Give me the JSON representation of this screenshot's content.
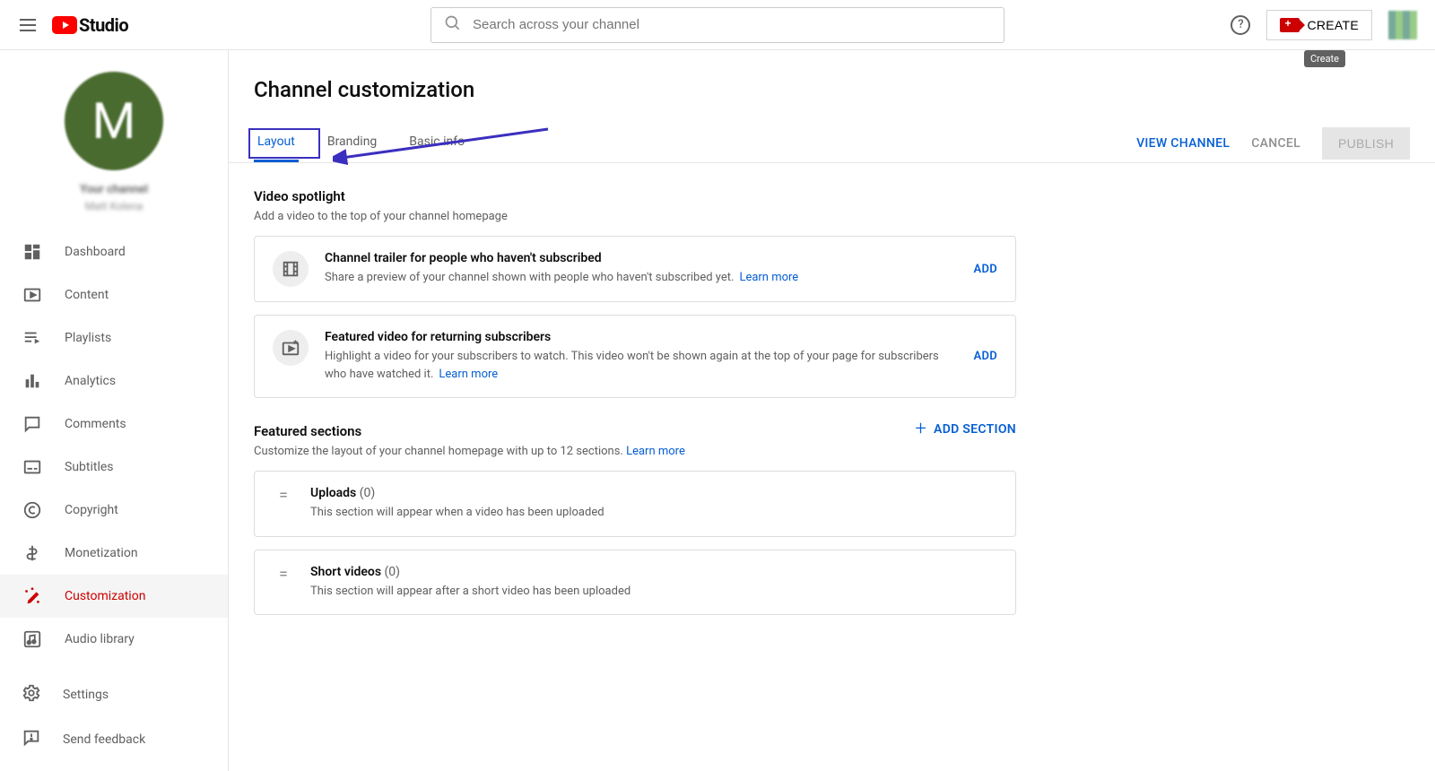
{
  "header": {
    "logo_text": "Studio",
    "search_placeholder": "Search across your channel",
    "create_label": "CREATE",
    "tooltip": "Create"
  },
  "sidebar": {
    "channel_label": "Your channel",
    "channel_name": "Matt Kolena",
    "avatar_letter": "M",
    "items": [
      {
        "label": "Dashboard"
      },
      {
        "label": "Content"
      },
      {
        "label": "Playlists"
      },
      {
        "label": "Analytics"
      },
      {
        "label": "Comments"
      },
      {
        "label": "Subtitles"
      },
      {
        "label": "Copyright"
      },
      {
        "label": "Monetization"
      },
      {
        "label": "Customization"
      },
      {
        "label": "Audio library"
      }
    ],
    "bottom": [
      {
        "label": "Settings"
      },
      {
        "label": "Send feedback"
      }
    ]
  },
  "main": {
    "title": "Channel customization",
    "tabs": [
      {
        "label": "Layout"
      },
      {
        "label": "Branding"
      },
      {
        "label": "Basic info"
      }
    ],
    "actions": {
      "view": "VIEW CHANNEL",
      "cancel": "CANCEL",
      "publish": "PUBLISH"
    },
    "spotlight": {
      "title": "Video spotlight",
      "desc": "Add a video to the top of your channel homepage",
      "cards": [
        {
          "title": "Channel trailer for people who haven't subscribed",
          "desc": "Share a preview of your channel shown with people who haven't subscribed yet.",
          "learn": "Learn more",
          "action": "ADD"
        },
        {
          "title": "Featured video for returning subscribers",
          "desc": "Highlight a video for your subscribers to watch. This video won't be shown again at the top of your page for subscribers who have watched it.",
          "learn": "Learn more",
          "action": "ADD"
        }
      ]
    },
    "featured": {
      "title": "Featured sections",
      "desc": "Customize the layout of your channel homepage with up to 12 sections.",
      "learn": "Learn more",
      "add": "ADD SECTION",
      "rows": [
        {
          "title": "Uploads",
          "count": "(0)",
          "desc": "This section will appear when a video has been uploaded"
        },
        {
          "title": "Short videos",
          "count": "(0)",
          "desc": "This section will appear after a short video has been uploaded"
        }
      ]
    }
  }
}
